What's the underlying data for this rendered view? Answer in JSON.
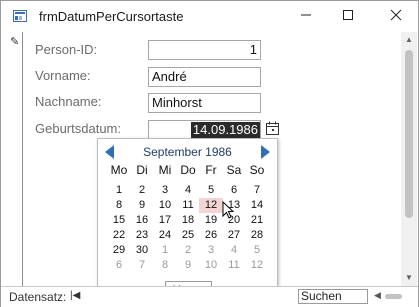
{
  "window": {
    "title": "frmDatumPerCursortaste"
  },
  "form": {
    "fields": [
      {
        "label": "Person-ID:",
        "value": "1"
      },
      {
        "label": "Vorname:",
        "value": "André"
      },
      {
        "label": "Nachname:",
        "value": "Minhorst"
      },
      {
        "label": "Geburtsdatum:",
        "value": "14.09.1986"
      }
    ]
  },
  "calendar": {
    "month_label": "September 1986",
    "weekdays": [
      "Mo",
      "Di",
      "Mi",
      "Do",
      "Fr",
      "Sa",
      "So"
    ],
    "weeks": [
      [
        "1",
        "2",
        "3",
        "4",
        "5",
        "6",
        "7"
      ],
      [
        "8",
        "9",
        "10",
        "11",
        "12",
        "13",
        "14"
      ],
      [
        "15",
        "16",
        "17",
        "18",
        "19",
        "20",
        "21"
      ],
      [
        "22",
        "23",
        "24",
        "25",
        "26",
        "27",
        "28"
      ],
      [
        "29",
        "30",
        "1",
        "2",
        "3",
        "4",
        "5"
      ],
      [
        "6",
        "7",
        "8",
        "9",
        "10",
        "11",
        "12"
      ]
    ],
    "selected_day": "12",
    "today_button": "Heute"
  },
  "statusbar": {
    "record_label": "Datensatz:",
    "search_placeholder": "Suchen"
  },
  "colors": {
    "accent": "#2f6fb8",
    "selection_bg": "#2b2b2b",
    "selected_day_bg": "#f3d4d4"
  }
}
